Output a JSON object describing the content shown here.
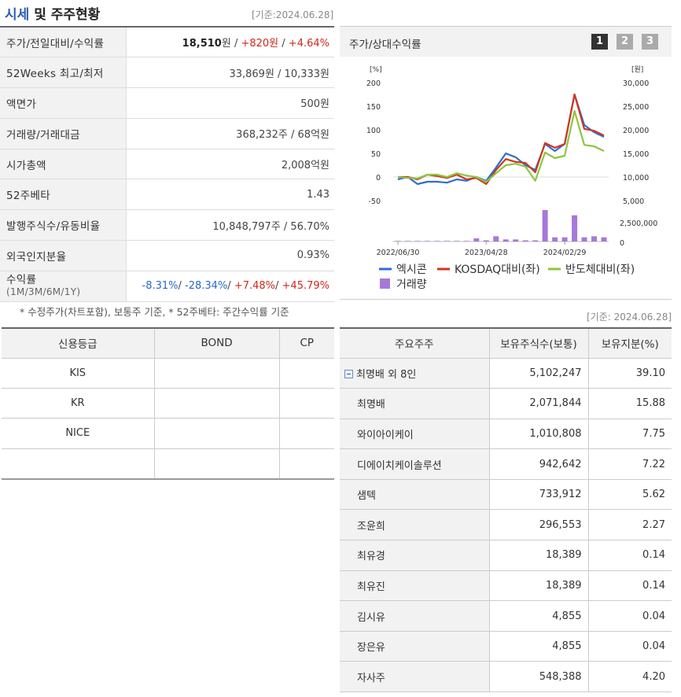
{
  "section": {
    "title_hl": "시세",
    "title_rest": " 및 주주현황",
    "base_date": "[기준:2024.06.28]"
  },
  "price_rows": [
    {
      "label": "주가/전일대비/수익률",
      "price": "18,510",
      "price_unit": "원",
      "sep1": " / ",
      "change": "+820원",
      "sep2": " / ",
      "rate": "+4.64%"
    },
    {
      "label": "52Weeks 최고/최저",
      "value": "33,869원 / 10,333원"
    },
    {
      "label": "액면가",
      "value": "500원"
    },
    {
      "label": "거래량/거래대금",
      "value": "368,232주 / 68억원"
    },
    {
      "label": "시가총액",
      "value": "2,008억원"
    },
    {
      "label": "52주베타",
      "value": "1.43"
    },
    {
      "label": "발행주식수/유동비율",
      "value": "10,848,797주 / 56.70%"
    },
    {
      "label": "외국인지분율",
      "value": "0.93%"
    }
  ],
  "returns": {
    "label": "수익률",
    "sublabel": "(1M/3M/6M/1Y)",
    "r1": "-8.31%",
    "r2": "-28.34%",
    "r3": "+7.48%",
    "r4": "+45.79%",
    "sep": "/ "
  },
  "footnote": "* 수정주가(차트포함), 보통주 기준, * 52주베타: 주간수익률 기준",
  "credit": {
    "headers": [
      "신용등급",
      "BOND",
      "CP"
    ],
    "rows": [
      [
        "KIS",
        "",
        ""
      ],
      [
        "KR",
        "",
        ""
      ],
      [
        "NICE",
        "",
        ""
      ],
      [
        "",
        "",
        ""
      ]
    ]
  },
  "chart_panel": {
    "title": "주가/상대수익률",
    "pages": [
      "1",
      "2",
      "3"
    ]
  },
  "chart_data": {
    "type": "line",
    "left_unit": "[%]",
    "right_unit": "[원]",
    "left_ticks": [
      "200",
      "150",
      "100",
      "50",
      "0",
      "-50"
    ],
    "right_ticks": [
      "30,000",
      "25,000",
      "20,000",
      "15,000",
      "10,000",
      "5,000"
    ],
    "volume_ticks": [
      "2,500,000",
      "0"
    ],
    "x_labels": [
      "2022/06/30",
      "2023/04/28",
      "2024/02/29"
    ],
    "x_count": 24,
    "ylim_left": [
      -50,
      200
    ],
    "colors": {
      "stock": "#2b6fd6",
      "kosdaq": "#d1361f",
      "semi": "#8cc63f",
      "volume": "#a679d9"
    },
    "series": [
      {
        "name": "엑시콘",
        "values": [
          -5,
          0,
          -15,
          -10,
          -10,
          -12,
          -5,
          -8,
          0,
          -8,
          20,
          50,
          42,
          25,
          15,
          70,
          55,
          70,
          175,
          110,
          95,
          85
        ]
      },
      {
        "name": "KOSDAQ대비(좌)",
        "values": [
          0,
          0,
          -5,
          5,
          2,
          -2,
          5,
          -5,
          -2,
          -15,
          15,
          38,
          32,
          30,
          10,
          72,
          62,
          70,
          175,
          102,
          98,
          88
        ]
      },
      {
        "name": "반도체대비(좌)",
        "values": [
          0,
          -2,
          -3,
          5,
          5,
          0,
          8,
          3,
          0,
          -10,
          8,
          25,
          28,
          22,
          -8,
          52,
          40,
          45,
          140,
          68,
          65,
          55
        ]
      }
    ],
    "volume": {
      "name": "거래량",
      "values": [
        0,
        0,
        0,
        0,
        0,
        0,
        0,
        0,
        3,
        1,
        5,
        2,
        2,
        1,
        1,
        30,
        4,
        4,
        25,
        4,
        5,
        4
      ]
    }
  },
  "holders": {
    "base_date": "[기준: 2024.06.28]",
    "headers": [
      "주요주주",
      "보유주식수(보통)",
      "보유지분(%)"
    ],
    "group": {
      "name": "최명배 외 8인",
      "shares": "5,102,247",
      "pct": "39.10"
    },
    "rows": [
      {
        "name": "최명배",
        "shares": "2,071,844",
        "pct": "15.88"
      },
      {
        "name": "와이아이케이",
        "shares": "1,010,808",
        "pct": "7.75"
      },
      {
        "name": "디에이치케이솔루션",
        "shares": "942,642",
        "pct": "7.22"
      },
      {
        "name": "샘텍",
        "shares": "733,912",
        "pct": "5.62"
      },
      {
        "name": "조윤희",
        "shares": "296,553",
        "pct": "2.27"
      },
      {
        "name": "최유경",
        "shares": "18,389",
        "pct": "0.14"
      },
      {
        "name": "최유진",
        "shares": "18,389",
        "pct": "0.14"
      },
      {
        "name": "김시유",
        "shares": "4,855",
        "pct": "0.04"
      },
      {
        "name": "장은유",
        "shares": "4,855",
        "pct": "0.04"
      },
      {
        "name": "자사주",
        "shares": "548,388",
        "pct": "4.20"
      }
    ]
  }
}
